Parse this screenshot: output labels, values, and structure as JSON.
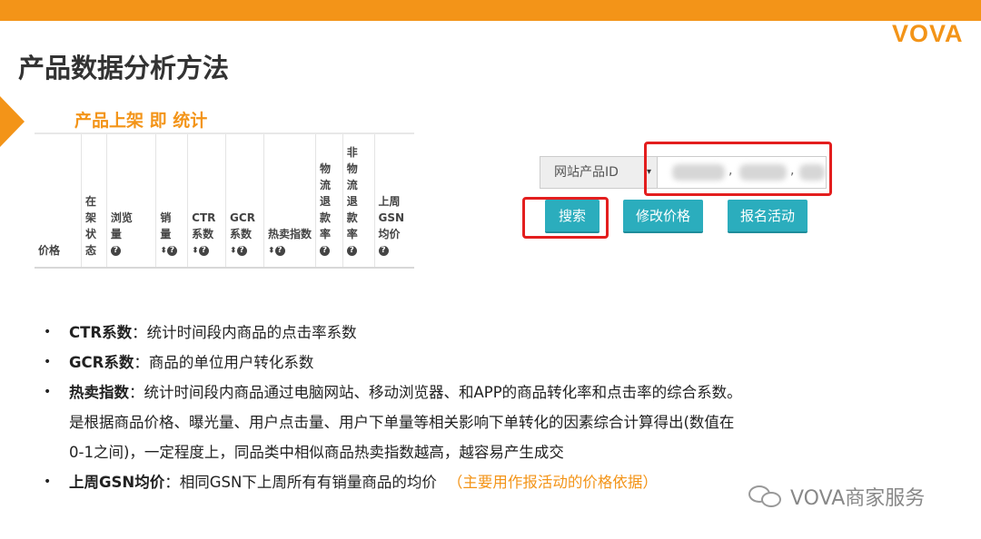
{
  "header": {
    "logo_text": "VOVA",
    "page_title": "产品数据分析方法",
    "accent_color": "#f39418"
  },
  "section": {
    "title": "产品上架 即 统计"
  },
  "stats_table": {
    "columns": [
      {
        "label": "价格",
        "stacked": false,
        "help": false,
        "sort": false
      },
      {
        "label": "在架状态",
        "stacked": true,
        "help": false,
        "sort": false
      },
      {
        "label": "浏览量",
        "stacked": false,
        "help": true,
        "sort": false
      },
      {
        "label": "销量",
        "stacked": true,
        "help": true,
        "sort": true
      },
      {
        "label": "CTR系数",
        "stacked": false,
        "help": true,
        "sort": true
      },
      {
        "label": "GCR系数",
        "stacked": false,
        "help": true,
        "sort": true
      },
      {
        "label": "热卖指数",
        "stacked": false,
        "help": true,
        "sort": true
      },
      {
        "label": "物流退款率",
        "stacked": true,
        "help": true,
        "sort": false
      },
      {
        "label": "非物流退款率",
        "stacked": true,
        "help": true,
        "sort": false
      },
      {
        "label": "上周GSN均价",
        "stacked": false,
        "help": true,
        "sort": false
      }
    ],
    "help_glyph": "?",
    "sort_glyph": "⬍"
  },
  "search": {
    "addon_label": "网站产品ID",
    "addon_caret": "▾",
    "input_separators": [
      ",",
      ","
    ]
  },
  "buttons": {
    "search": "搜索",
    "modify_price": "修改价格",
    "register_activity": "报名活动",
    "button_color": "#2badbd",
    "highlight_box_color": "#e31e1e"
  },
  "notes": [
    {
      "term": "CTR系数",
      "text": "：统计时间段内商品的点击率系数"
    },
    {
      "term": "GCR系数",
      "text": "：商品的单位用户转化系数"
    },
    {
      "term": "热卖指数",
      "text": "：统计时间段内商品通过电脑网站、移动浏览器、和APP的商品转化率和点击率的综合系数。"
    },
    {
      "term": "",
      "text": "是根据商品价格、曝光量、用户点击量、用户下单量等相关影响下单转化的因素综合计算得出(数值在"
    },
    {
      "term": "",
      "text": "0-1之间)，一定程度上，同品类中相似商品热卖指数越高，越容易产生成交"
    },
    {
      "term": "上周GSN均价",
      "text": "：相同GSN下上周所有有销量商品的均价",
      "highlight": "（主要用作报活动的价格依据）"
    }
  ],
  "watermark": {
    "text": "VOVA商家服务",
    "icon": "wechat-icon"
  }
}
